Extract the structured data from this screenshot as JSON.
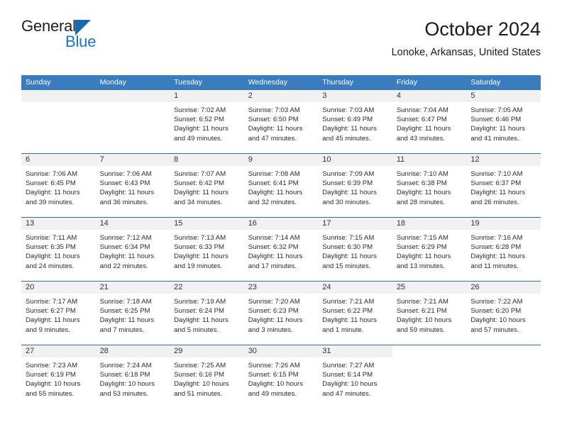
{
  "brand": {
    "line1": "General",
    "line2": "Blue",
    "triangle_color": "#1769b0",
    "text_color": "#231f20",
    "blue_text_color": "#1179c4"
  },
  "header": {
    "title": "October 2024",
    "subtitle": "Lonoke, Arkansas, United States"
  },
  "theme": {
    "header_blue": "#3b7cbe",
    "row_divider": "#2f6ea5",
    "daynum_band": "#f1f1f1"
  },
  "weekdays": [
    "Sunday",
    "Monday",
    "Tuesday",
    "Wednesday",
    "Thursday",
    "Friday",
    "Saturday"
  ],
  "labels": {
    "sunrise_prefix": "Sunrise:",
    "sunset_prefix": "Sunset:",
    "daylight_prefix": "Daylight:"
  },
  "weeks": [
    [
      {
        "day": "",
        "empty": true
      },
      {
        "day": "",
        "empty": true
      },
      {
        "day": "1",
        "sunrise": "Sunrise: 7:02 AM",
        "sunset": "Sunset: 6:52 PM",
        "daylight_line1": "Daylight: 11 hours",
        "daylight_line2": "and 49 minutes."
      },
      {
        "day": "2",
        "sunrise": "Sunrise: 7:03 AM",
        "sunset": "Sunset: 6:50 PM",
        "daylight_line1": "Daylight: 11 hours",
        "daylight_line2": "and 47 minutes."
      },
      {
        "day": "3",
        "sunrise": "Sunrise: 7:03 AM",
        "sunset": "Sunset: 6:49 PM",
        "daylight_line1": "Daylight: 11 hours",
        "daylight_line2": "and 45 minutes."
      },
      {
        "day": "4",
        "sunrise": "Sunrise: 7:04 AM",
        "sunset": "Sunset: 6:47 PM",
        "daylight_line1": "Daylight: 11 hours",
        "daylight_line2": "and 43 minutes."
      },
      {
        "day": "5",
        "sunrise": "Sunrise: 7:05 AM",
        "sunset": "Sunset: 6:46 PM",
        "daylight_line1": "Daylight: 11 hours",
        "daylight_line2": "and 41 minutes."
      }
    ],
    [
      {
        "day": "6",
        "sunrise": "Sunrise: 7:06 AM",
        "sunset": "Sunset: 6:45 PM",
        "daylight_line1": "Daylight: 11 hours",
        "daylight_line2": "and 39 minutes."
      },
      {
        "day": "7",
        "sunrise": "Sunrise: 7:06 AM",
        "sunset": "Sunset: 6:43 PM",
        "daylight_line1": "Daylight: 11 hours",
        "daylight_line2": "and 36 minutes."
      },
      {
        "day": "8",
        "sunrise": "Sunrise: 7:07 AM",
        "sunset": "Sunset: 6:42 PM",
        "daylight_line1": "Daylight: 11 hours",
        "daylight_line2": "and 34 minutes."
      },
      {
        "day": "9",
        "sunrise": "Sunrise: 7:08 AM",
        "sunset": "Sunset: 6:41 PM",
        "daylight_line1": "Daylight: 11 hours",
        "daylight_line2": "and 32 minutes."
      },
      {
        "day": "10",
        "sunrise": "Sunrise: 7:09 AM",
        "sunset": "Sunset: 6:39 PM",
        "daylight_line1": "Daylight: 11 hours",
        "daylight_line2": "and 30 minutes."
      },
      {
        "day": "11",
        "sunrise": "Sunrise: 7:10 AM",
        "sunset": "Sunset: 6:38 PM",
        "daylight_line1": "Daylight: 11 hours",
        "daylight_line2": "and 28 minutes."
      },
      {
        "day": "12",
        "sunrise": "Sunrise: 7:10 AM",
        "sunset": "Sunset: 6:37 PM",
        "daylight_line1": "Daylight: 11 hours",
        "daylight_line2": "and 26 minutes."
      }
    ],
    [
      {
        "day": "13",
        "sunrise": "Sunrise: 7:11 AM",
        "sunset": "Sunset: 6:35 PM",
        "daylight_line1": "Daylight: 11 hours",
        "daylight_line2": "and 24 minutes."
      },
      {
        "day": "14",
        "sunrise": "Sunrise: 7:12 AM",
        "sunset": "Sunset: 6:34 PM",
        "daylight_line1": "Daylight: 11 hours",
        "daylight_line2": "and 22 minutes."
      },
      {
        "day": "15",
        "sunrise": "Sunrise: 7:13 AM",
        "sunset": "Sunset: 6:33 PM",
        "daylight_line1": "Daylight: 11 hours",
        "daylight_line2": "and 19 minutes."
      },
      {
        "day": "16",
        "sunrise": "Sunrise: 7:14 AM",
        "sunset": "Sunset: 6:32 PM",
        "daylight_line1": "Daylight: 11 hours",
        "daylight_line2": "and 17 minutes."
      },
      {
        "day": "17",
        "sunrise": "Sunrise: 7:15 AM",
        "sunset": "Sunset: 6:30 PM",
        "daylight_line1": "Daylight: 11 hours",
        "daylight_line2": "and 15 minutes."
      },
      {
        "day": "18",
        "sunrise": "Sunrise: 7:15 AM",
        "sunset": "Sunset: 6:29 PM",
        "daylight_line1": "Daylight: 11 hours",
        "daylight_line2": "and 13 minutes."
      },
      {
        "day": "19",
        "sunrise": "Sunrise: 7:16 AM",
        "sunset": "Sunset: 6:28 PM",
        "daylight_line1": "Daylight: 11 hours",
        "daylight_line2": "and 11 minutes."
      }
    ],
    [
      {
        "day": "20",
        "sunrise": "Sunrise: 7:17 AM",
        "sunset": "Sunset: 6:27 PM",
        "daylight_line1": "Daylight: 11 hours",
        "daylight_line2": "and 9 minutes."
      },
      {
        "day": "21",
        "sunrise": "Sunrise: 7:18 AM",
        "sunset": "Sunset: 6:25 PM",
        "daylight_line1": "Daylight: 11 hours",
        "daylight_line2": "and 7 minutes."
      },
      {
        "day": "22",
        "sunrise": "Sunrise: 7:19 AM",
        "sunset": "Sunset: 6:24 PM",
        "daylight_line1": "Daylight: 11 hours",
        "daylight_line2": "and 5 minutes."
      },
      {
        "day": "23",
        "sunrise": "Sunrise: 7:20 AM",
        "sunset": "Sunset: 6:23 PM",
        "daylight_line1": "Daylight: 11 hours",
        "daylight_line2": "and 3 minutes."
      },
      {
        "day": "24",
        "sunrise": "Sunrise: 7:21 AM",
        "sunset": "Sunset: 6:22 PM",
        "daylight_line1": "Daylight: 11 hours",
        "daylight_line2": "and 1 minute."
      },
      {
        "day": "25",
        "sunrise": "Sunrise: 7:21 AM",
        "sunset": "Sunset: 6:21 PM",
        "daylight_line1": "Daylight: 10 hours",
        "daylight_line2": "and 59 minutes."
      },
      {
        "day": "26",
        "sunrise": "Sunrise: 7:22 AM",
        "sunset": "Sunset: 6:20 PM",
        "daylight_line1": "Daylight: 10 hours",
        "daylight_line2": "and 57 minutes."
      }
    ],
    [
      {
        "day": "27",
        "sunrise": "Sunrise: 7:23 AM",
        "sunset": "Sunset: 6:19 PM",
        "daylight_line1": "Daylight: 10 hours",
        "daylight_line2": "and 55 minutes."
      },
      {
        "day": "28",
        "sunrise": "Sunrise: 7:24 AM",
        "sunset": "Sunset: 6:18 PM",
        "daylight_line1": "Daylight: 10 hours",
        "daylight_line2": "and 53 minutes."
      },
      {
        "day": "29",
        "sunrise": "Sunrise: 7:25 AM",
        "sunset": "Sunset: 6:16 PM",
        "daylight_line1": "Daylight: 10 hours",
        "daylight_line2": "and 51 minutes."
      },
      {
        "day": "30",
        "sunrise": "Sunrise: 7:26 AM",
        "sunset": "Sunset: 6:15 PM",
        "daylight_line1": "Daylight: 10 hours",
        "daylight_line2": "and 49 minutes."
      },
      {
        "day": "31",
        "sunrise": "Sunrise: 7:27 AM",
        "sunset": "Sunset: 6:14 PM",
        "daylight_line1": "Daylight: 10 hours",
        "daylight_line2": "and 47 minutes."
      },
      {
        "day": "",
        "blank": true
      },
      {
        "day": "",
        "blank": true
      }
    ]
  ]
}
